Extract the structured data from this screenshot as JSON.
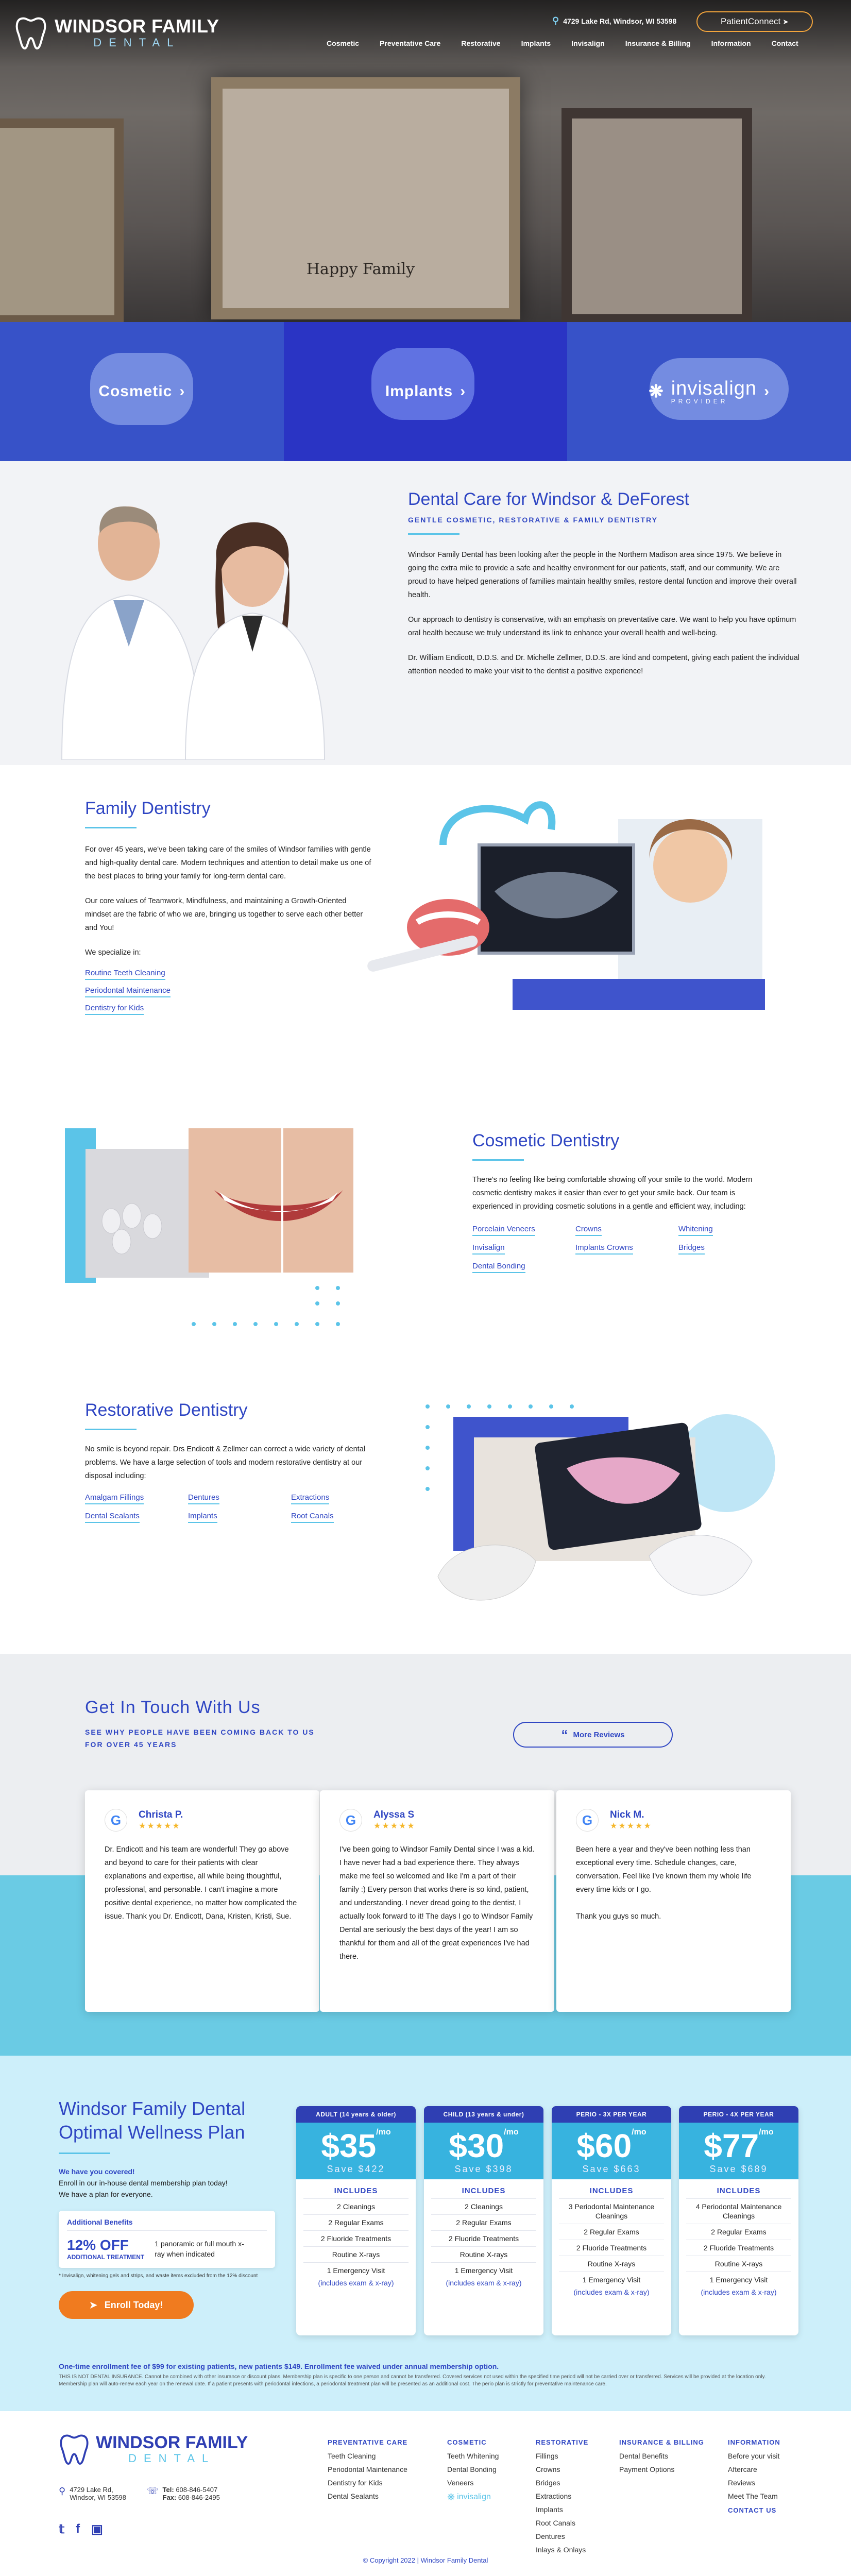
{
  "header": {
    "logo_name": "WINDSOR FAMILY",
    "logo_sub": "DENTAL",
    "address": "4729 Lake Rd, Windsor, WI 53598",
    "patient_connect": "PatientConnect",
    "nav": [
      "Cosmetic",
      "Preventative Care",
      "Restorative",
      "Implants",
      "Invisalign",
      "Insurance & Billing",
      "Information",
      "Contact"
    ]
  },
  "hero": {
    "plaque": "Happy Family"
  },
  "tiles": {
    "cosmetic": "Cosmetic",
    "implants": "Implants",
    "invisalign": "invisalign",
    "invisalign_sub": "PROVIDER"
  },
  "intro": {
    "title": "Dental Care for Windsor & DeForest",
    "subtitle": "GENTLE COSMETIC, RESTORATIVE & FAMILY DENTISTRY",
    "p1": "Windsor Family Dental has been looking after the people in the Northern Madison area since 1975. We believe in going the extra mile to provide a safe and healthy environment for our patients, staff, and our community. We are proud to have helped generations of families maintain healthy smiles, restore dental function and improve their overall health.",
    "p2": "Our approach to dentistry is conservative, with an emphasis on preventative care. We want to help you have optimum oral health because we truly understand its link to enhance your overall health and well-being.",
    "p3": "Dr. William Endicott, D.D.S. and Dr. Michelle Zellmer, D.D.S. are kind and competent, giving each patient the individual attention needed to make your visit to the dentist a positive experience!"
  },
  "family": {
    "title": "Family Dentistry",
    "p1": "For over 45 years, we've been taking care of the smiles of Windsor families with gentle and high-quality dental care. Modern techniques and attention to detail make us one of the best places to bring your family for long-term dental care.",
    "p2": "Our core values of Teamwork, Mindfulness, and maintaining a Growth-Oriented mindset are the fabric of who we are, bringing us together to serve each other better and You!",
    "p3": "We specialize in:",
    "links": [
      "Routine Teeth Cleaning",
      "Periodontal Maintenance",
      "Dentistry for Kids"
    ]
  },
  "cosmetic": {
    "title": "Cosmetic Dentistry",
    "p1": "There's no feeling like being comfortable showing off your smile to the world. Modern cosmetic dentistry makes it easier than ever to get your smile back. Our team is experienced in providing cosmetic solutions in a gentle and efficient way, including:",
    "links": [
      "Porcelain Veneers",
      "Crowns",
      "Whitening",
      "Invisalign",
      "Implants Crowns",
      "Bridges",
      "Dental Bonding"
    ]
  },
  "restorative": {
    "title": "Restorative Dentistry",
    "p1": "No smile is beyond repair. Drs Endicott & Zellmer can correct a wide variety of dental problems. We have a large selection of tools and modern restorative dentistry at our disposal including:",
    "links": [
      "Amalgam Fillings",
      "Dentures",
      "Extractions",
      "Dental Sealants",
      "Implants",
      "Root Canals"
    ]
  },
  "reviews": {
    "title": "Get In Touch With Us",
    "subtitle": "SEE WHY PEOPLE HAVE BEEN COMING BACK TO US FOR OVER 45 YEARS",
    "more": "More Reviews",
    "stars": "★★★★★",
    "items": [
      {
        "name": "Christa P.",
        "text": "Dr. Endicott and his team are wonderful! They go above and beyond to care for their patients with clear explanations and expertise, all while being thoughtful, professional, and personable. I can't imagine a more positive dental experience, no matter how complicated the issue. Thank you Dr. Endicott, Dana, Kristen, Kristi, Sue."
      },
      {
        "name": "Alyssa S",
        "text": "I've been going to Windsor Family Dental since I was a kid. I have never had a bad experience there. They always make me feel so welcomed and like I'm a part of their family :) Every person that works there is so kind, patient, and understanding. I never dread going to the dentist, I actually look forward to it! The days I go to Windsor Family Dental are seriously the best days of the year! I am so thankful for them and all of the great experiences I've had there."
      },
      {
        "name": "Nick M.",
        "text": "Been here a year and they've been nothing less than exceptional every time. Schedule changes, care, conversation. Feel like I've known them my whole life every time kids or I go.\n\nThank you guys so much."
      }
    ]
  },
  "plan": {
    "title": "Windsor Family Dental Optimal Wellness Plan",
    "covered": "We have you covered!",
    "enroll": "Enroll in our in-house dental membership plan today!",
    "plan_for": "We have a plan for everyone.",
    "addl_title": "Additional Benefits",
    "addl_pct": "12% OFF",
    "addl_pct_sub": "ADDITIONAL TREATMENT",
    "addl_right": "1 panoramic or full mouth x-ray when indicated",
    "fine": "* Invisalign, whitening gels and strips, and waste items excluded from the 12% discount",
    "enroll_btn": "Enroll Today!",
    "footnote": "One-time enrollment fee of $99 for existing patients, new patients $149. Enrollment fee waived under annual membership option.",
    "disclaimer": "THIS IS NOT DENTAL INSURANCE. Cannot be combined with other insurance or discount plans. Membership plan is specific to one person and cannot be transferred. Covered services not used within the specified time period will not be carried over or transferred. Services will be provided at the location only. Membership plan will auto-renew each year on the renewal date. If a patient presents with periodontal infections, a periodontal treatment plan will be presented as an additional cost. The perio plan is strictly for preventative maintenance care.",
    "includes": "INCLUDES",
    "plans": [
      {
        "label": "ADULT (14 years & older)",
        "price": "$35",
        "mo": "/mo",
        "save": "Save $422",
        "rows": [
          "2 Cleanings",
          "2 Regular Exams",
          "2 Fluoride Treatments",
          "Routine X-rays",
          "1 Emergency Visit",
          "(includes exam & x-ray)"
        ]
      },
      {
        "label": "CHILD (13 years & under)",
        "price": "$30",
        "mo": "/mo",
        "save": "Save $398",
        "rows": [
          "2 Cleanings",
          "2 Regular Exams",
          "2 Fluoride Treatments",
          "Routine X-rays",
          "1 Emergency Visit",
          "(includes exam & x-ray)"
        ]
      },
      {
        "label": "PERIO - 3X PER YEAR",
        "price": "$60",
        "mo": "/mo",
        "save": "Save $663",
        "rows": [
          "3 Periodontal Maintenance Cleanings",
          "2 Regular Exams",
          "2 Fluoride Treatments",
          "Routine X-rays",
          "1 Emergency Visit",
          "(includes exam & x-ray)"
        ]
      },
      {
        "label": "PERIO - 4X PER YEAR",
        "price": "$77",
        "mo": "/mo",
        "save": "Save $689",
        "rows": [
          "4 Periodontal Maintenance Cleanings",
          "2 Regular Exams",
          "2 Fluoride Treatments",
          "Routine X-rays",
          "1 Emergency Visit",
          "(includes exam & x-ray)"
        ]
      }
    ]
  },
  "footer": {
    "address1": "4729 Lake Rd,",
    "address2": "Windsor, WI 53598",
    "tel_label": "Tel:",
    "tel": "608-846-5407",
    "fax_label": "Fax:",
    "fax": "608-846-2495",
    "copyright": "© Copyright 2022 | Windsor Family Dental",
    "cols": [
      {
        "title": "PREVENTATIVE CARE",
        "items": [
          "Teeth Cleaning",
          "Periodontal Maintenance",
          "Dentistry for Kids",
          "Dental Sealants"
        ]
      },
      {
        "title": "COSMETIC",
        "items": [
          "Teeth Whitening",
          "Dental Bonding",
          "Veneers"
        ]
      },
      {
        "title": "RESTORATIVE",
        "items": [
          "Fillings",
          "Crowns",
          "Bridges",
          "Extractions",
          "Implants",
          "Root Canals",
          "Dentures",
          "Inlays & Onlays"
        ]
      },
      {
        "title": "INSURANCE & BILLING",
        "items": [
          "Dental Benefits",
          "Payment Options"
        ]
      },
      {
        "title": "INFORMATION",
        "items": [
          "Before your visit",
          "Aftercare",
          "Reviews",
          "Meet The Team"
        ]
      }
    ],
    "contact": "CONTACT US"
  },
  "colors": {
    "brand_blue": "#2f46c3",
    "accent_cyan": "#5bc4e8",
    "orange": "#f07b1f"
  }
}
